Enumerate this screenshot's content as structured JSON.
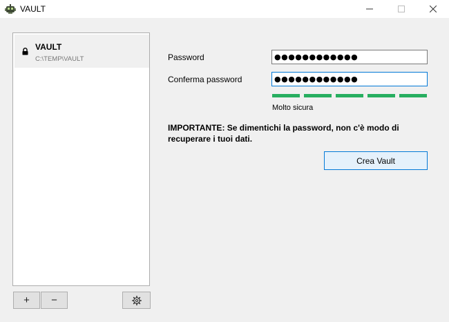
{
  "window": {
    "title": "VAULT",
    "icon": "cryptomator-robot-icon"
  },
  "vaults": [
    {
      "name": "VAULT",
      "path": "C:\\TEMP\\VAULT",
      "status_icon": "lock-icon"
    }
  ],
  "toolbar": {
    "add_label": "+",
    "remove_label": "−",
    "settings_icon": "gear-icon"
  },
  "form": {
    "password_label": "Password",
    "password_value": "●●●●●●●●●●●●",
    "confirm_label": "Conferma password",
    "confirm_value": "●●●●●●●●●●●●",
    "strength": {
      "filled": 5,
      "total": 5,
      "label": "Molto sicura",
      "color": "#27ae60"
    },
    "warning": "IMPORTANTE: Se dimentichi la password, non c'è modo di recuperare i tuoi dati.",
    "create_label": "Crea Vault"
  },
  "colors": {
    "focus_border": "#0078d7",
    "window_bg": "#f0f0f0"
  }
}
